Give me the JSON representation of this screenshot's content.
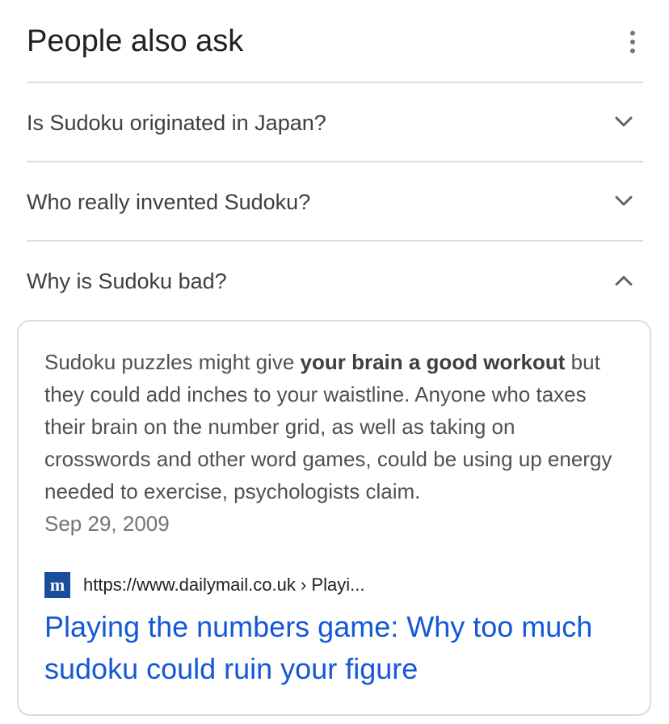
{
  "header": {
    "title": "People also ask",
    "more_icon": "more-vertical-icon"
  },
  "questions": [
    {
      "text": "Is Sudoku originated in Japan?",
      "icon": "chevron-down-icon",
      "expanded": false
    },
    {
      "text": "Who really invented Sudoku?",
      "icon": "chevron-down-icon",
      "expanded": false
    },
    {
      "text": "Why is Sudoku bad?",
      "icon": "chevron-up-icon",
      "expanded": true
    }
  ],
  "answer": {
    "snippet_before": "Sudoku puzzles might give ",
    "snippet_bold": "your brain a good workout",
    "snippet_after": " but they could add inches to your waistline. Anyone who taxes their brain on the number grid, as well as taking on crosswords and other word games, could be using up energy needed to exercise, psychologists claim.",
    "date": "Sep 29, 2009",
    "favicon_letter": "m",
    "source_url": "https://www.dailymail.co.uk › Playi...",
    "link_title": "Playing the numbers game: Why too much sudoku could ruin your figure"
  },
  "colors": {
    "link": "#1558d6",
    "divider": "#dadce0",
    "favicon_bg": "#1a4d9c"
  }
}
